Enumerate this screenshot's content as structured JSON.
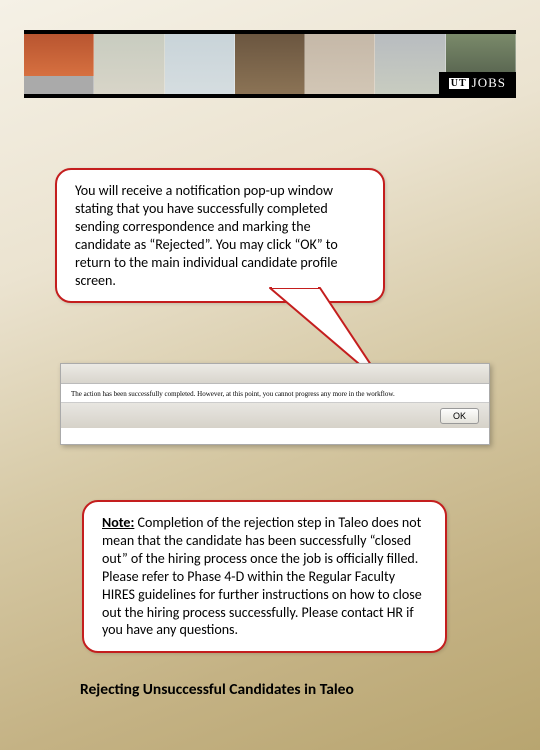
{
  "header": {
    "logo_text": "JOBS",
    "logo_prefix": "UT"
  },
  "callout1": {
    "text": "You will receive a notification pop-up window stating that you have successfully completed sending correspondence and marking the candidate as “Rejected”.  You may click “OK” to return to the main individual candidate profile screen."
  },
  "screenshot": {
    "message": "The action has been successfully completed. However, at this point, you cannot progress any more in the workflow.",
    "ok_label": "OK"
  },
  "callout2": {
    "note_label": "Note:",
    "text": " Completion of the rejection step in Taleo does not mean that the candidate has been successfully “closed out” of the hiring process once the job is officially filled.  Please refer to Phase 4-D within the Regular Faculty HIRES guidelines for further instructions on how to close out the hiring process successfully.  Please contact HR if you have any questions."
  },
  "footer": {
    "title": "Rejecting Unsuccessful Candidates in Taleo"
  }
}
